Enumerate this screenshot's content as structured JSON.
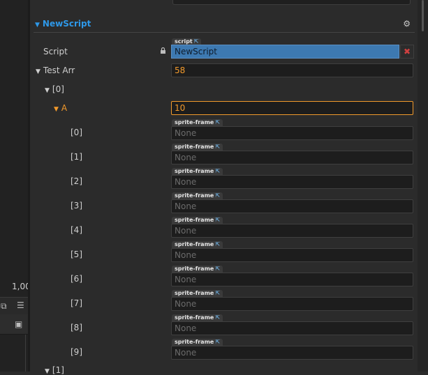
{
  "left_pane": {
    "coordinate_readout": "1,00"
  },
  "component": {
    "title": "NewScript"
  },
  "script_row": {
    "label": "Script",
    "tag": "script",
    "value": "NewScript"
  },
  "test_arr": {
    "label": "Test Arr",
    "value": "58"
  },
  "item0": {
    "label": "[0]"
  },
  "a": {
    "label": "A",
    "value": "10"
  },
  "sprite_tag": "sprite-frame",
  "elements": [
    {
      "label": "[0]",
      "value": "None"
    },
    {
      "label": "[1]",
      "value": "None"
    },
    {
      "label": "[2]",
      "value": "None"
    },
    {
      "label": "[3]",
      "value": "None"
    },
    {
      "label": "[4]",
      "value": "None"
    },
    {
      "label": "[5]",
      "value": "None"
    },
    {
      "label": "[6]",
      "value": "None"
    },
    {
      "label": "[7]",
      "value": "None"
    },
    {
      "label": "[8]",
      "value": "None"
    },
    {
      "label": "[9]",
      "value": "None"
    }
  ],
  "item1": {
    "label": "[1]"
  },
  "colors": {
    "accent_blue": "#2e98e8",
    "orange": "#f29a2c",
    "script_bg": "#3d79b1"
  }
}
